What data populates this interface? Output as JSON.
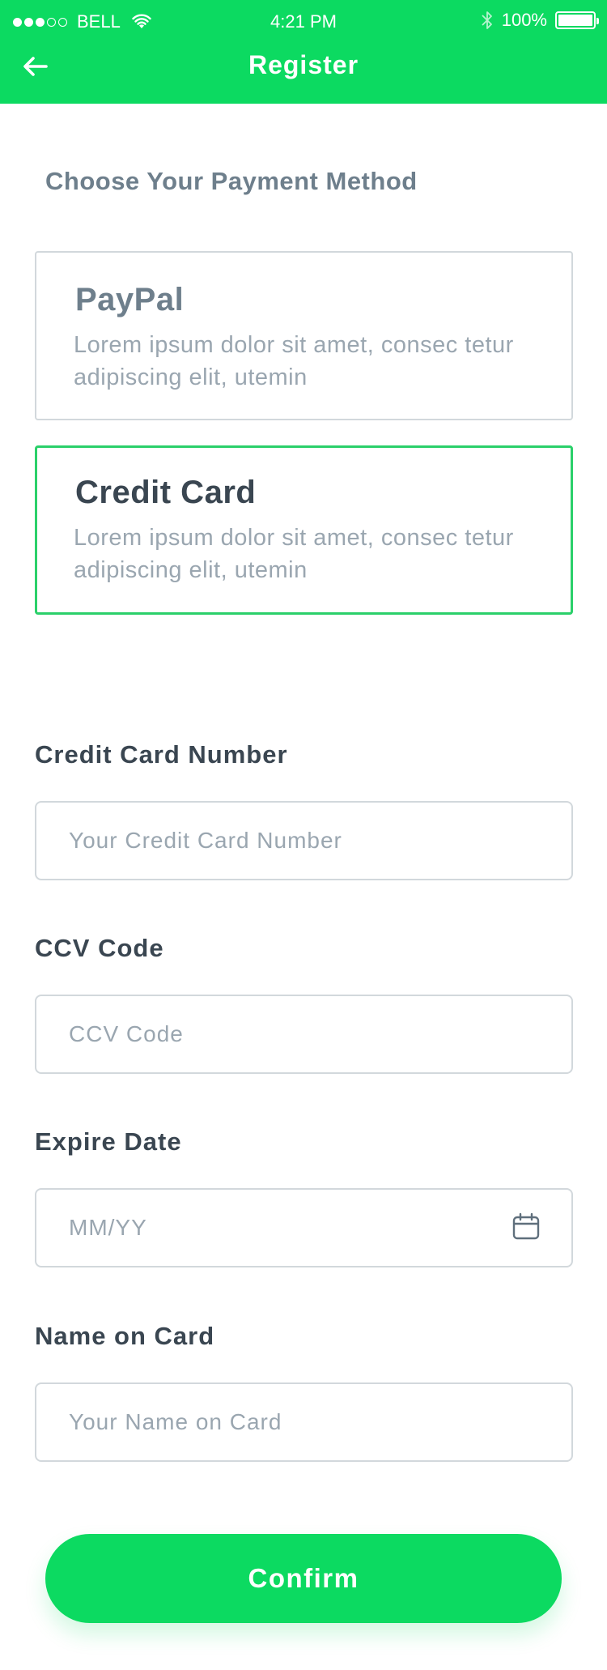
{
  "status_bar": {
    "carrier": "BELL",
    "time": "4:21 PM",
    "battery": "100%"
  },
  "nav": {
    "title": "Register"
  },
  "payment": {
    "section_title": "Choose Your Payment Method",
    "options": [
      {
        "title": "PayPal",
        "description": "Lorem ipsum dolor sit amet, consec tetur adipiscing elit, utemin",
        "selected": false
      },
      {
        "title": "Credit Card",
        "description": "Lorem ipsum dolor sit amet, consec tetur adipiscing elit, utemin",
        "selected": true
      }
    ]
  },
  "form": {
    "card_number": {
      "label": "Credit Card Number",
      "placeholder": "Your Credit Card Number"
    },
    "ccv": {
      "label": "CCV Code",
      "placeholder": "CCV Code"
    },
    "expire": {
      "label": "Expire Date",
      "placeholder": "MM/YY"
    },
    "name": {
      "label": "Name on Card",
      "placeholder": "Your Name on Card"
    }
  },
  "confirm_label": "Confirm",
  "colors": {
    "accent": "#0cda61",
    "selected_border": "#2bd06a",
    "text_dark": "#3a4651",
    "text_muted": "#6e7f8c",
    "placeholder": "#9aa6b0",
    "border": "#d2d8dc"
  },
  "icons": [
    "signal-dots-icon",
    "wifi-icon",
    "bluetooth-icon",
    "battery-icon",
    "back-arrow-icon",
    "calendar-icon"
  ]
}
